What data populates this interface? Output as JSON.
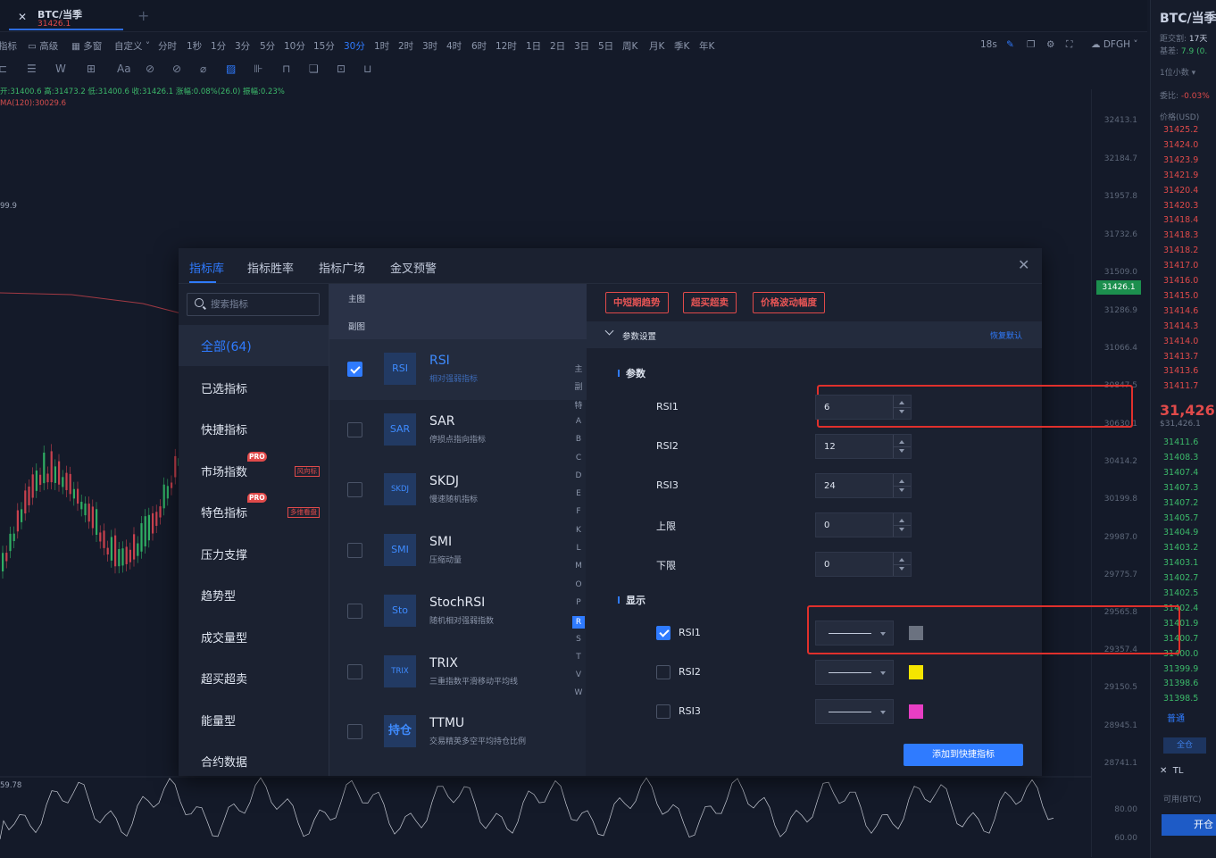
{
  "tab": {
    "title": "BTC/当季",
    "price": "31426.1",
    "plus": "+"
  },
  "intervals": {
    "items": [
      "指标",
      "高级",
      "多窗",
      "自定义",
      "分时",
      "1秒",
      "1分",
      "3分",
      "5分",
      "10分",
      "15分",
      "30分",
      "1时",
      "2时",
      "3时",
      "4时",
      "6时",
      "12时",
      "1日",
      "2日",
      "3日",
      "5日",
      "周K",
      "月K",
      "季K",
      "年K"
    ],
    "selected": "30分",
    "right": [
      "18s",
      "DFGH"
    ]
  },
  "legend": {
    "ohlc": "开:31400.6  高:31473.2  低:31400.6  收:31426.1  涨幅:0.08%(26.0)  振幅:0.23%",
    "ma": "MA(120):30029.6",
    "ma99": "99.9",
    "sub": "59.78"
  },
  "axis": {
    "labels": [
      "32413.1",
      "32184.7",
      "31957.8",
      "31732.6",
      "31509.0",
      "31286.9",
      "31066.4",
      "30847.5",
      "30630.1",
      "30414.2",
      "30199.8",
      "29987.0",
      "29775.7",
      "29565.8",
      "29357.4",
      "29150.5",
      "28945.1",
      "28741.1"
    ],
    "current": "31426.1",
    "sub_labels": [
      "80.00",
      "60.00"
    ]
  },
  "right_panel": {
    "title": "BTC/当季",
    "expiry_label": "距交割:",
    "expiry_value": "17天",
    "basis_label": "基差:",
    "basis_value": "7.9 (0.",
    "lot": "1位小数",
    "ratio_label": "委比:",
    "ratio_value": "-0.03%",
    "price_header": "价格(USD)",
    "asks": [
      "31425.2",
      "31424.0",
      "31423.9",
      "31421.9",
      "31420.4",
      "31420.3",
      "31418.4",
      "31418.3",
      "31418.2",
      "31417.0",
      "31416.0",
      "31415.0",
      "31414.6",
      "31414.3",
      "31414.0",
      "31413.7",
      "31413.6",
      "31411.7"
    ],
    "last": "31,426.1",
    "last_usd": "$31,426.1",
    "bids": [
      "31411.6",
      "31408.3",
      "31407.4",
      "31407.3",
      "31407.2",
      "31405.7",
      "31404.9",
      "31403.2",
      "31403.1",
      "31402.7",
      "31402.5",
      "31402.4",
      "31401.9",
      "31400.7",
      "31400.0",
      "31399.9",
      "31398.6",
      "31398.5"
    ],
    "order_tab": "普通",
    "all": "全仓",
    "tl": "TL",
    "available": "可用(BTC)",
    "open": "开仓"
  },
  "modal": {
    "tabs": [
      "指标库",
      "指标胜率",
      "指标广场",
      "金叉预警"
    ],
    "active_tab": 0,
    "search_placeholder": "搜索指标",
    "categories": [
      {
        "label": "全部(64)",
        "active": true
      },
      {
        "label": "已选指标"
      },
      {
        "label": "快捷指标"
      },
      {
        "label": "市场指数",
        "pro": "PRO",
        "tag": "风向标"
      },
      {
        "label": "特色指标",
        "pro": "PRO",
        "tag": "多维看盘"
      },
      {
        "label": "压力支撑"
      },
      {
        "label": "趋势型"
      },
      {
        "label": "成交量型"
      },
      {
        "label": "超买超卖"
      },
      {
        "label": "能量型"
      },
      {
        "label": "合约数据"
      }
    ],
    "mid_top": [
      "主图",
      "副图"
    ],
    "indicators": [
      {
        "icon": "RSI",
        "name": "RSI",
        "desc": "相对强弱指标",
        "checked": true,
        "active": true
      },
      {
        "icon": "SAR",
        "name": "SAR",
        "desc": "停损点指向指标",
        "checked": false
      },
      {
        "icon": "SKDJ",
        "name": "SKDJ",
        "desc": "慢速随机指标",
        "checked": false
      },
      {
        "icon": "SMI",
        "name": "SMI",
        "desc": "压缩动量",
        "checked": false
      },
      {
        "icon": "Sto",
        "name": "StochRSI",
        "desc": "随机相对强弱指数",
        "checked": false
      },
      {
        "icon": "TRIX",
        "name": "TRIX",
        "desc": "三重指数平滑移动平均线",
        "checked": false
      },
      {
        "icon": "持仓",
        "name": "TTMU",
        "desc": "交易精英多空平均持仓比例",
        "checked": false
      }
    ],
    "alpha": [
      "主",
      "副",
      "特",
      "A",
      "B",
      "C",
      "D",
      "E",
      "F",
      "K",
      "L",
      "M",
      "O",
      "P",
      "R",
      "S",
      "T",
      "V",
      "W"
    ],
    "alpha_selected": "R",
    "tags": [
      "中短期趋势",
      "超买超卖",
      "价格波动幅度"
    ],
    "param_header": "参数设置",
    "restore": "恢复默认",
    "param_section": "参数",
    "params": [
      {
        "label": "RSI1",
        "value": "6"
      },
      {
        "label": "RSI2",
        "value": "12"
      },
      {
        "label": "RSI3",
        "value": "24"
      },
      {
        "label": "上限",
        "value": "0"
      },
      {
        "label": "下限",
        "value": "0"
      }
    ],
    "display_section": "显示",
    "display": [
      {
        "label": "RSI1",
        "checked": true,
        "color": "#6b7280"
      },
      {
        "label": "RSI2",
        "checked": false,
        "color": "#f5e500"
      },
      {
        "label": "RSI3",
        "checked": false,
        "color": "#e83ec4"
      }
    ],
    "add_button": "添加到快捷指标"
  }
}
